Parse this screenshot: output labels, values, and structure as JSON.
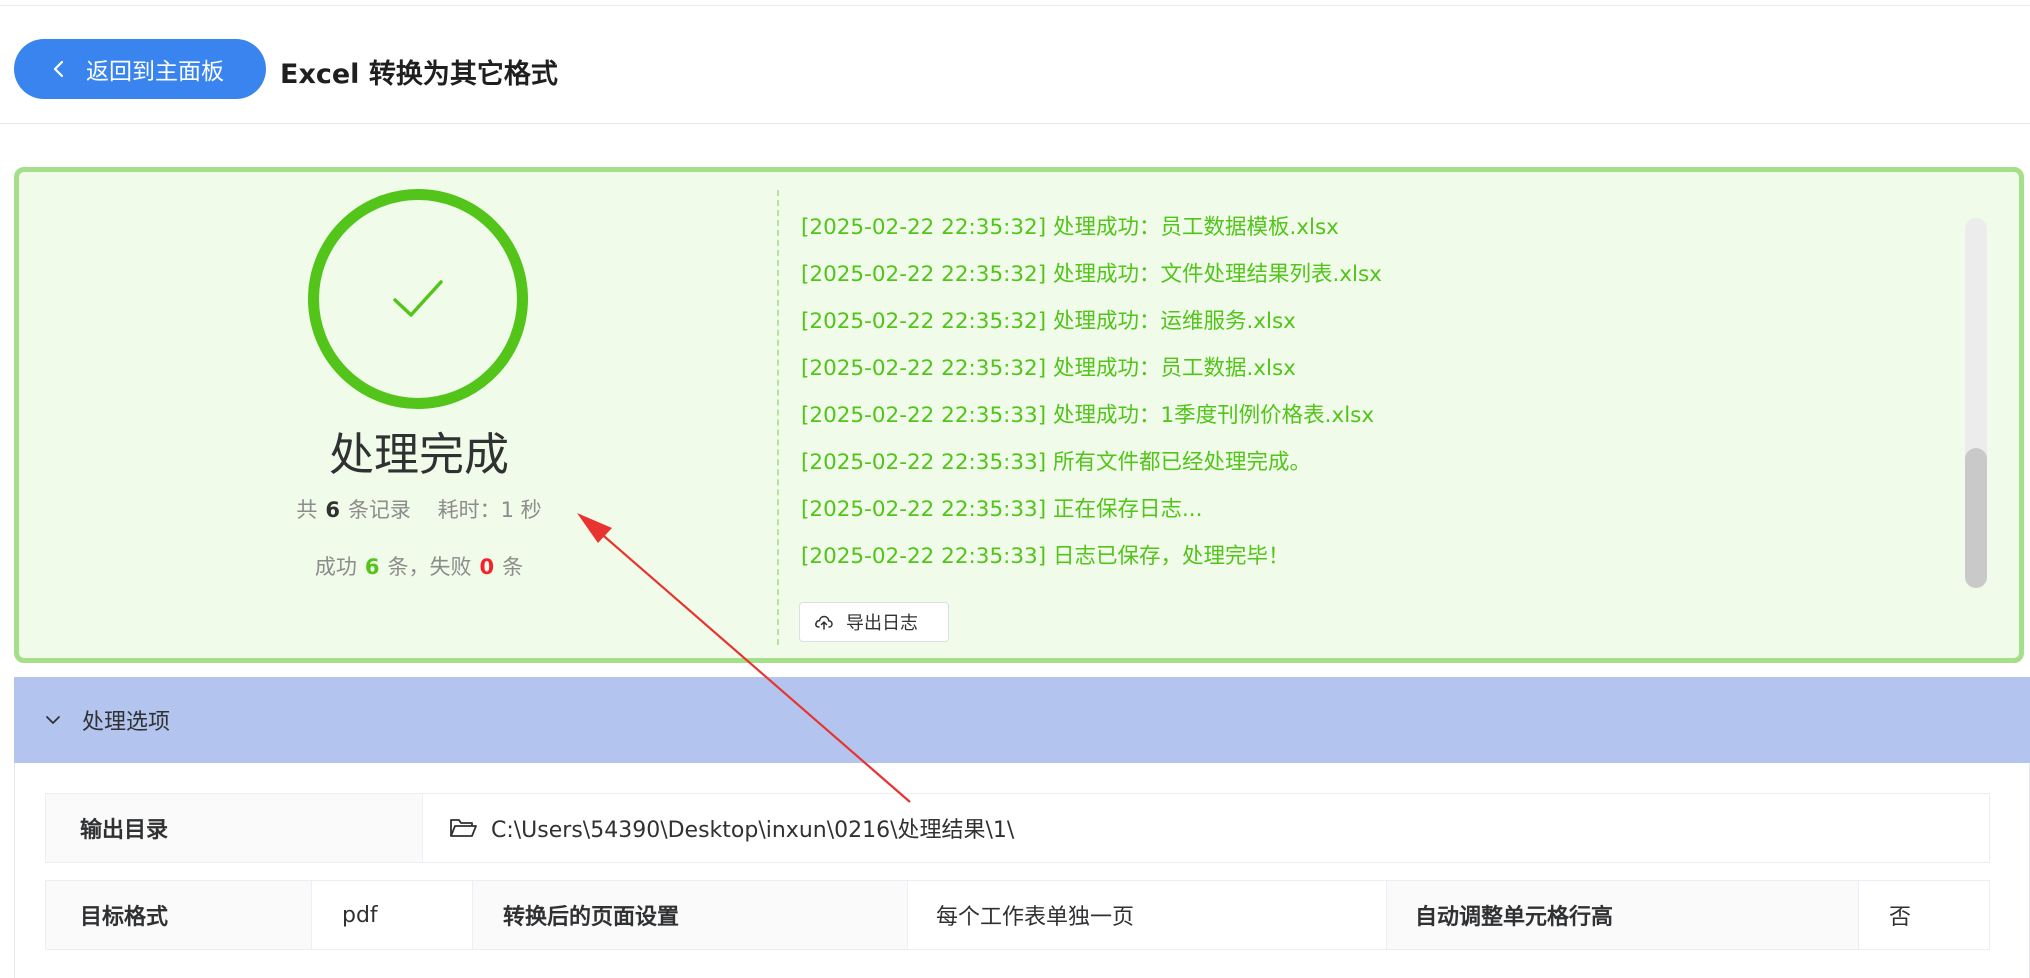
{
  "header": {
    "back_label": "返回到主面板",
    "title": "Excel 转换为其它格式"
  },
  "result": {
    "status_title": "处理完成",
    "total_prefix": "共",
    "total_count": "6",
    "total_suffix": "条记录",
    "time_label": "耗时：1 秒",
    "success_prefix": "成功",
    "success_count": "6",
    "success_suffix": "条，失败",
    "fail_count": "0",
    "fail_suffix": "条",
    "colors": {
      "success": "#52c41a",
      "fail": "#f5222d"
    },
    "icon": "check-icon"
  },
  "log": {
    "lines": [
      "[2025-02-22 22:35:32] 处理成功：员工数据模板.xlsx",
      "[2025-02-22 22:35:32] 处理成功：文件处理结果列表.xlsx",
      "[2025-02-22 22:35:32] 处理成功：运维服务.xlsx",
      "[2025-02-22 22:35:32] 处理成功：员工数据.xlsx",
      "[2025-02-22 22:35:33] 处理成功：1季度刊例价格表.xlsx",
      "[2025-02-22 22:35:33] 所有文件都已经处理完成。",
      "[2025-02-22 22:35:33] 正在保存日志...",
      "[2025-02-22 22:35:33] 日志已保存，处理完毕！"
    ],
    "export_label": "导出日志"
  },
  "options": {
    "section_title": "处理选项",
    "output_dir_label": "输出目录",
    "output_dir_value": "C:\\Users\\54390\\Desktop\\inxun\\0216\\处理结果\\1\\",
    "target_format_label": "目标格式",
    "target_format_value": "pdf",
    "page_setting_label": "转换后的页面设置",
    "page_setting_value": "每个工作表单独一页",
    "auto_row_height_label": "自动调整单元格行高",
    "auto_row_height_value": "否"
  }
}
